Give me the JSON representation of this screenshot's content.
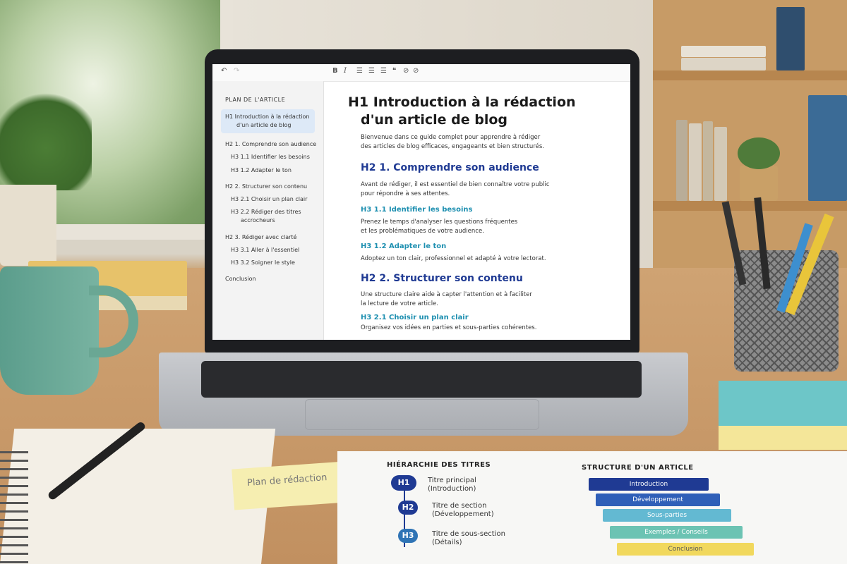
{
  "editor": {
    "toolbar": {
      "undo_icon": "undo-icon",
      "redo_icon": "redo-icon",
      "bold": "B",
      "italic": "I"
    },
    "outline": {
      "title": "PLAN DE L'ARTICLE",
      "items": [
        {
          "label": "H1 Introduction à la rédaction",
          "label2": "d'un article de blog"
        },
        {
          "label": "H2 1. Comprendre son audience"
        },
        {
          "label": "H3 1.1 Identifier les besoins"
        },
        {
          "label": "H3 1.2 Adapter le ton"
        },
        {
          "label": "H2 2. Structurer son contenu"
        },
        {
          "label": "H3 2.1 Choisir un plan clair"
        },
        {
          "label": "H3 2.2 Rédiger des titres",
          "label2": "accrocheurs"
        },
        {
          "label": "H2 3. Rédiger avec clarté"
        },
        {
          "label": "H3 3.1 Aller à l'essentiel"
        },
        {
          "label": "H3 3.2 Soigner le style"
        },
        {
          "label": "Conclusion"
        }
      ]
    },
    "document": {
      "h1_line1": "H1 Introduction à la rédaction",
      "h1_line2": "d'un article de blog",
      "intro_l1": "Bienvenue dans ce guide complet pour apprendre à rédiger",
      "intro_l2": "des articles de blog efficaces, engageants et bien structurés.",
      "h2_1": "H2 1. Comprendre son audience",
      "p_h2_1_l1": "Avant de rédiger, il est essentiel de bien connaître votre public",
      "p_h2_1_l2": "pour répondre à ses attentes.",
      "h3_11": "H3 1.1 Identifier les besoins",
      "p_h3_11_l1": "Prenez le temps d'analyser les questions fréquentes",
      "p_h3_11_l2": "et les problématiques de votre audience.",
      "h3_12": "H3 1.2 Adapter le ton",
      "p_h3_12": "Adoptez un ton clair, professionnel et adapté à votre lectorat.",
      "h2_2": "H2 2. Structurer son contenu",
      "p_h2_2_l1": "Une structure claire aide à capter l'attention et à faciliter",
      "p_h2_2_l2": "la lecture de votre article.",
      "h3_21": "H3 2.1 Choisir un plan clair",
      "p_h3_21": "Organisez vos idées en parties et sous-parties cohérentes."
    }
  },
  "desk": {
    "sticky_note": "Plan de rédaction",
    "paper_left": {
      "title": "HIÉRARCHIE DES TITRES",
      "levels": [
        {
          "badge": "H1",
          "line1": "Titre principal",
          "line2": "(Introduction)"
        },
        {
          "badge": "H2",
          "line1": "Titre de section",
          "line2": "(Développement)"
        },
        {
          "badge": "H3",
          "line1": "Titre de sous-section",
          "line2": "(Détails)"
        }
      ]
    },
    "paper_right": {
      "title": "STRUCTURE D'UN ARTICLE",
      "bars": [
        {
          "label": "Introduction",
          "color": "#1f3a93"
        },
        {
          "label": "Développement",
          "color": "#2f5fb8"
        },
        {
          "label": "Sous-parties",
          "color": "#63b9d2"
        },
        {
          "label": "Exemples / Conseils",
          "color": "#6cc3b3"
        },
        {
          "label": "Conclusion",
          "color": "#f1d85d"
        }
      ]
    }
  }
}
